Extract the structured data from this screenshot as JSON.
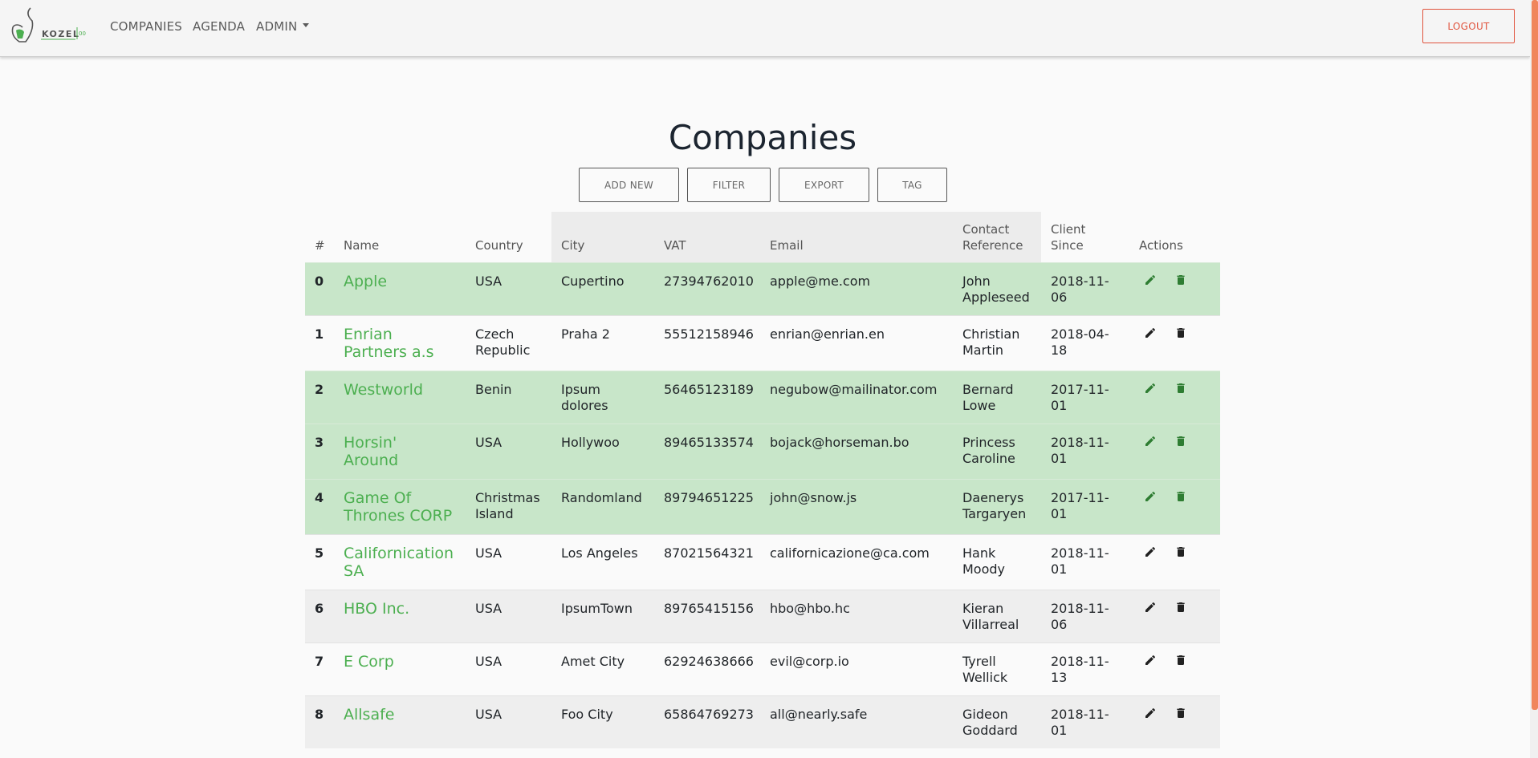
{
  "nav": {
    "logo_text": "KOZEL",
    "logo_suffix": "00",
    "companies": "COMPANIES",
    "agenda": "AGENDA",
    "admin": "ADMIN",
    "logout": "LOGOUT"
  },
  "page": {
    "title": "Companies"
  },
  "toolbar": {
    "add_new": "ADD NEW",
    "filter": "FILTER",
    "export": "EXPORT",
    "tag": "TAG"
  },
  "table": {
    "headers": [
      "#",
      "Name",
      "Country",
      "City",
      "VAT",
      "Email",
      "Contact Reference",
      "Client Since",
      "Actions"
    ],
    "rows": [
      {
        "idx": "0",
        "name": "Apple",
        "country": "USA",
        "city": "Cupertino",
        "vat": "27394762010",
        "email": "apple@me.com",
        "contact": "John Appleseed",
        "since": "2018-11-06",
        "style": "green"
      },
      {
        "idx": "1",
        "name": "Enrian Partners a.s",
        "country": "Czech Republic",
        "city": "Praha 2",
        "vat": "55512158946",
        "email": "enrian@enrian.en",
        "contact": "Christian Martin",
        "since": "2018-04-18",
        "style": "white"
      },
      {
        "idx": "2",
        "name": "Westworld",
        "country": "Benin",
        "city": "Ipsum dolores",
        "vat": "56465123189",
        "email": "negubow@mailinator.com",
        "contact": "Bernard Lowe",
        "since": "2017-11-01",
        "style": "green"
      },
      {
        "idx": "3",
        "name": "Horsin' Around",
        "country": "USA",
        "city": "Hollywoo",
        "vat": "89465133574",
        "email": "bojack@horseman.bo",
        "contact": "Princess Caroline",
        "since": "2018-11-01",
        "style": "green"
      },
      {
        "idx": "4",
        "name": "Game Of Thrones CORP",
        "country": "Christmas Island",
        "city": "Randomland",
        "vat": "89794651225",
        "email": "john@snow.js",
        "contact": "Daenerys Targaryen",
        "since": "2017-11-01",
        "style": "green"
      },
      {
        "idx": "5",
        "name": "Californication SA",
        "country": "USA",
        "city": "Los Angeles",
        "vat": "87021564321",
        "email": "californicazione@ca.com",
        "contact": "Hank Moody",
        "since": "2018-11-01",
        "style": "white"
      },
      {
        "idx": "6",
        "name": "HBO Inc.",
        "country": "USA",
        "city": "IpsumTown",
        "vat": "89765415156",
        "email": "hbo@hbo.hc",
        "contact": "Kieran Villarreal",
        "since": "2018-11-06",
        "style": "gray"
      },
      {
        "idx": "7",
        "name": "E Corp",
        "country": "USA",
        "city": "Amet City",
        "vat": "62924638666",
        "email": "evil@corp.io",
        "contact": "Tyrell Wellick",
        "since": "2018-11-13",
        "style": "white"
      },
      {
        "idx": "8",
        "name": "Allsafe",
        "country": "USA",
        "city": "Foo City",
        "vat": "65864769273",
        "email": "all@nearly.safe",
        "contact": "Gideon Goddard",
        "since": "2018-11-01",
        "style": "gray"
      }
    ],
    "row_actions": [
      "edit-icon",
      "delete-icon"
    ]
  },
  "colors": {
    "accent_green": "#4caf50",
    "row_green": "#c8e6c9",
    "logout_red": "#e0533d",
    "scrollbar": "#f0855c"
  }
}
